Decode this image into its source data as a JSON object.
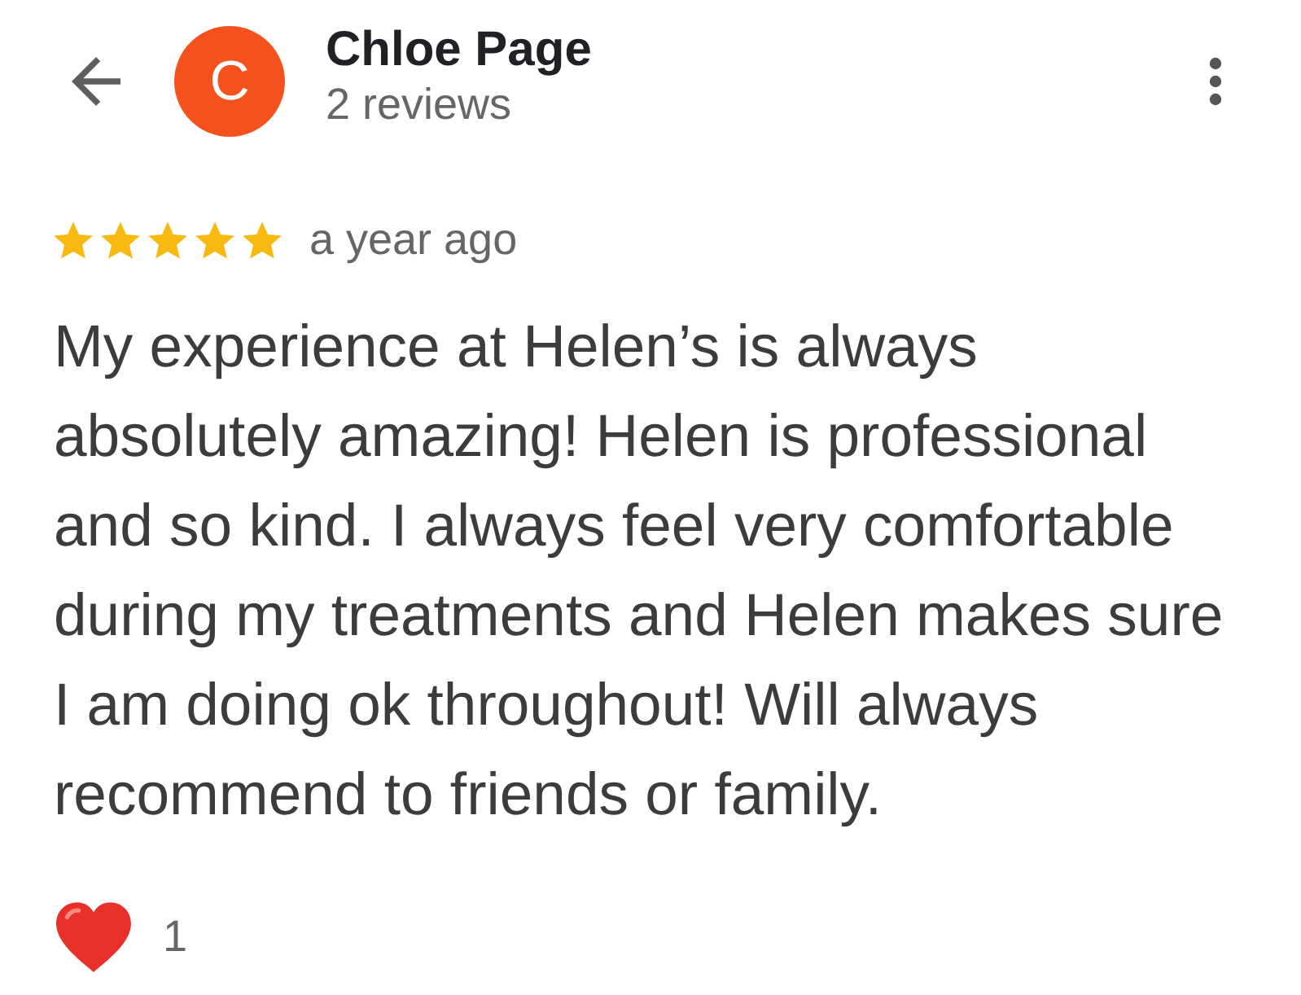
{
  "header": {
    "avatar_letter": "C",
    "name": "Chloe Page",
    "subtitle": "2 reviews"
  },
  "review": {
    "stars": 5,
    "time": "a year ago",
    "text": "My experience at Helen’s is always absolutely amazing! Helen is professional and so kind. I always feel very comfortable during my treatments and Helen makes sure I am doing ok throughout! Will always recommend to friends or family."
  },
  "reactions": {
    "count": "1"
  }
}
